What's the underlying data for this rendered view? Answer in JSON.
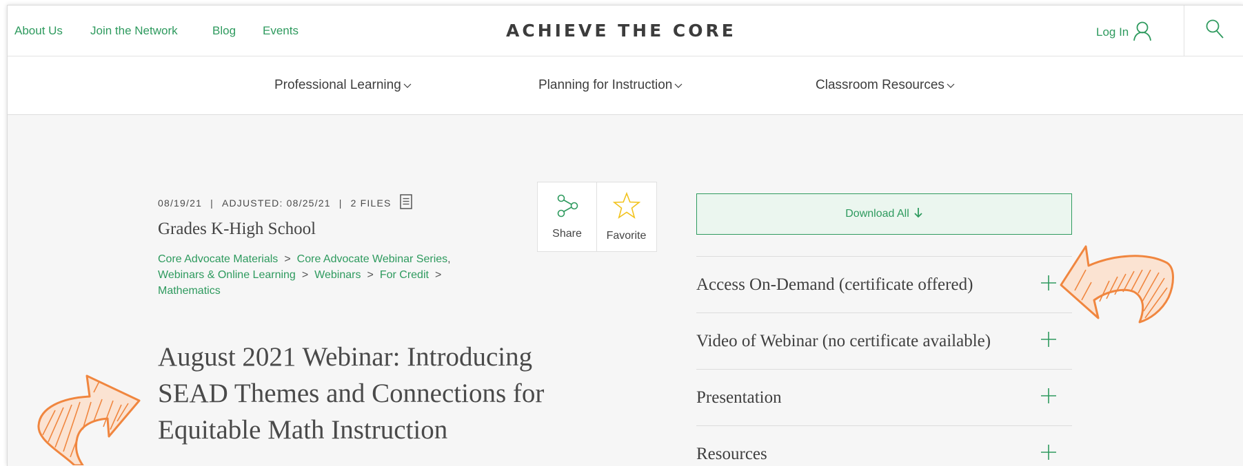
{
  "topbar": {
    "links": [
      "About Us",
      "Join the Network",
      "Blog",
      "Events"
    ],
    "logo": "ACHIEVE THE CORE",
    "login_label": "Log In"
  },
  "mainnav": {
    "items": [
      "Professional Learning",
      "Planning for Instruction",
      "Classroom Resources"
    ]
  },
  "meta": {
    "date": "08/19/21",
    "adjusted": "ADJUSTED: 08/25/21",
    "files": "2 FILES",
    "separator": "|"
  },
  "grades": "Grades K-High School",
  "breadcrumbs": {
    "line1": [
      "Core Advocate Materials",
      "Core Advocate Webinar Series"
    ],
    "line2": [
      "Webinars & Online Learning",
      "Webinars",
      "For Credit"
    ],
    "line3": [
      "Mathematics"
    ],
    "separator": ">",
    "comma": ","
  },
  "title": "August 2021 Webinar: Introducing SEAD Themes and Connections for Equitable Math Instruction",
  "actions": {
    "share_label": "Share",
    "favorite_label": "Favorite"
  },
  "download_label": "Download All",
  "accordion": [
    "Access On-Demand (certificate offered)",
    "Video of Webinar (no certificate available)",
    "Presentation",
    "Resources"
  ],
  "colors": {
    "accent": "#2e9a5e",
    "annotation_arrow": "#f0863f",
    "star": "#f2c21b",
    "background": "#f6f6f6"
  }
}
